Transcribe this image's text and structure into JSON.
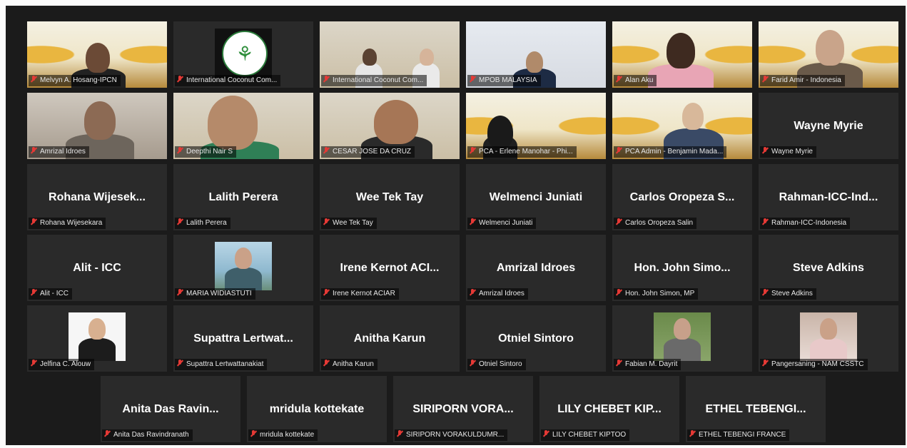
{
  "participants": [
    {
      "label": "Melvyn A. Hosang-IPCN",
      "big": "",
      "kind": "video"
    },
    {
      "label": "International Coconut Com...",
      "big": "",
      "kind": "logo"
    },
    {
      "label": "International Coconut Com...",
      "big": "",
      "kind": "video"
    },
    {
      "label": "MPOB MALAYSIA",
      "big": "",
      "kind": "video"
    },
    {
      "label": "Alan Aku",
      "big": "",
      "kind": "video"
    },
    {
      "label": "Farid Amir - Indonesia",
      "big": "",
      "kind": "video"
    },
    {
      "label": "Amrizal Idroes",
      "big": "",
      "kind": "video"
    },
    {
      "label": "Deepthi Nair S",
      "big": "",
      "kind": "video"
    },
    {
      "label": "CESAR JOSE DA CRUZ",
      "big": "",
      "kind": "video"
    },
    {
      "label": "PCA - Erlene Manohar - Phi...",
      "big": "",
      "kind": "video"
    },
    {
      "label": "PCA Admin - Benjamin Mada...",
      "big": "",
      "kind": "video"
    },
    {
      "label": "Wayne Myrie",
      "big": "Wayne Myrie",
      "kind": "name"
    },
    {
      "label": "Rohana Wijesekara",
      "big": "Rohana Wijesek...",
      "kind": "name"
    },
    {
      "label": "Lalith Perera",
      "big": "Lalith Perera",
      "kind": "name"
    },
    {
      "label": "Wee Tek Tay",
      "big": "Wee Tek Tay",
      "kind": "name"
    },
    {
      "label": "Welmenci Juniati",
      "big": "Welmenci Juniati",
      "kind": "name"
    },
    {
      "label": "Carlos Oropeza Salin",
      "big": "Carlos Oropeza S...",
      "kind": "name"
    },
    {
      "label": "Rahman-ICC-Indonesia",
      "big": "Rahman-ICC-Ind...",
      "kind": "name"
    },
    {
      "label": "Alit - ICC",
      "big": "Alit - ICC",
      "kind": "name"
    },
    {
      "label": "MARIA WIDIASTUTI",
      "big": "",
      "kind": "photo"
    },
    {
      "label": "Irene Kernot ACIAR",
      "big": "Irene Kernot ACI...",
      "kind": "name"
    },
    {
      "label": "Amrizal Idroes",
      "big": "Amrizal Idroes",
      "kind": "name"
    },
    {
      "label": "Hon. John Simon, MP",
      "big": "Hon. John Simo...",
      "kind": "name"
    },
    {
      "label": "Steve Adkins",
      "big": "Steve Adkins",
      "kind": "name"
    },
    {
      "label": "Jelfina C. Alouw",
      "big": "",
      "kind": "photo"
    },
    {
      "label": "Supattra Lertwattanakiat",
      "big": "Supattra  Lertwat...",
      "kind": "name"
    },
    {
      "label": "Anitha Karun",
      "big": "Anitha Karun",
      "kind": "name"
    },
    {
      "label": "Otniel Sintoro",
      "big": "Otniel Sintoro",
      "kind": "name"
    },
    {
      "label": "Fabian M. Dayrit",
      "big": "",
      "kind": "photo"
    },
    {
      "label": "Pangersaning - NAM CSSTC",
      "big": "",
      "kind": "photo"
    },
    {
      "label": "Anita Das Ravindranath",
      "big": "Anita Das Ravin...",
      "kind": "name"
    },
    {
      "label": "mridula kottekate",
      "big": "mridula kottekate",
      "kind": "name"
    },
    {
      "label": "SIRIPORN VORAKULDUMR...",
      "big": "SIRIPORN VORA...",
      "kind": "name"
    },
    {
      "label": "LILY CHEBET KIPTOO",
      "big": "LILY CHEBET KIP...",
      "kind": "name"
    },
    {
      "label": "ETHEL TEBENGI FRANCE",
      "big": "ETHEL TEBENGI...",
      "kind": "name"
    }
  ],
  "colors": {
    "muted_icon": "#e53935",
    "active_speaker": "#c9d84a",
    "tile_bg": "#2a2a2a"
  }
}
